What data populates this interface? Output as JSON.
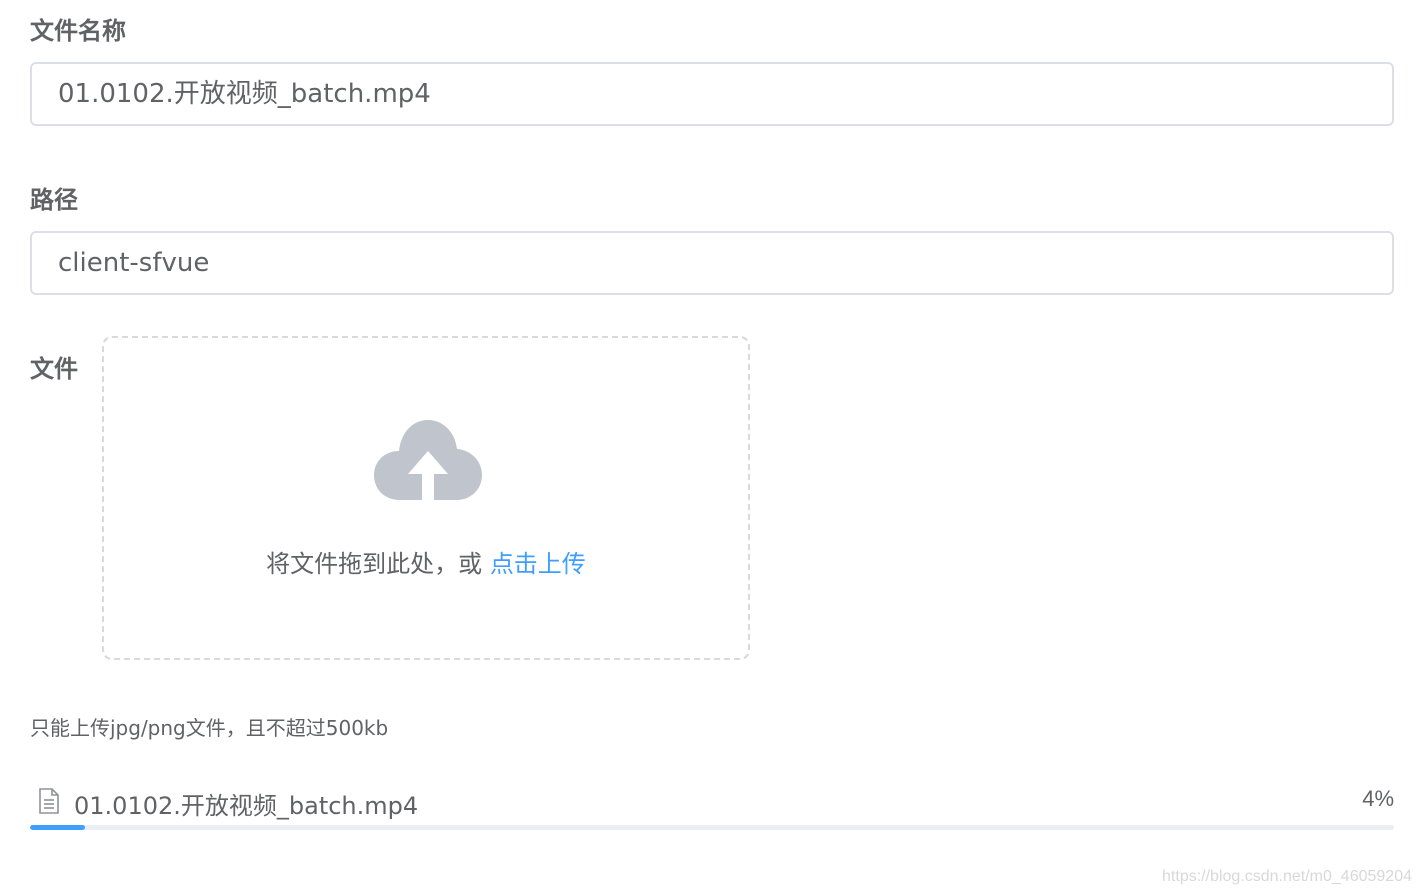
{
  "form": {
    "file_name_label": "文件名称",
    "file_name_value": "01.0102.开放视频_batch.mp4",
    "path_label": "路径",
    "path_value": "client-sfvue",
    "file_label": "文件"
  },
  "upload": {
    "icon": "upload-cloud-icon",
    "drop_text": "将文件拖到此处，或 ",
    "click_text": "点击上传",
    "tip": "只能上传jpg/png文件，且不超过500kb"
  },
  "file_list": [
    {
      "icon": "document-icon",
      "name": "01.0102.开放视频_batch.mp4",
      "percent_text": "4%",
      "progress": 0.04
    }
  ],
  "watermark": "https://blog.csdn.net/m0_46059204",
  "colors": {
    "accent": "#409eff",
    "text": "#606266",
    "border": "#dcdfe6",
    "icon": "#c0c4cc"
  }
}
